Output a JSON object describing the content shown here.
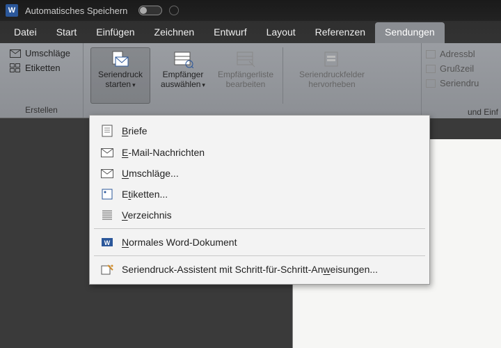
{
  "titlebar": {
    "autosave": "Automatisches Speichern"
  },
  "tabs": {
    "datei": "Datei",
    "start": "Start",
    "einfuegen": "Einfügen",
    "zeichnen": "Zeichnen",
    "entwurf": "Entwurf",
    "layout": "Layout",
    "referenzen": "Referenzen",
    "sendungen": "Sendungen"
  },
  "ribbon": {
    "erstellen": {
      "label": "Erstellen",
      "umschlaege": "Umschläge",
      "etiketten": "Etiketten"
    },
    "seriendruck": {
      "starten_l1": "Seriendruck",
      "starten_l2": "starten",
      "empfaenger_l1": "Empfänger",
      "empfaenger_l2": "auswählen",
      "liste_l1": "Empfängerliste",
      "liste_l2": "bearbeiten",
      "felder_l1": "Seriendruckfelder",
      "felder_l2": "hervorheben"
    },
    "side": {
      "adress": "Adressbl",
      "gruss": "Grußzeil",
      "serien": "Seriendru",
      "footer": "und Einf"
    }
  },
  "dropdown": {
    "briefe": "Briefe",
    "email": "E-Mail-Nachrichten",
    "umschlaege": "Umschläge...",
    "etiketten": "Etiketten...",
    "verzeichnis": "Verzeichnis",
    "normal": "Normales Word-Dokument",
    "assistent": "Seriendruck-Assistent mit Schritt-für-Schritt-Anweisungen..."
  }
}
